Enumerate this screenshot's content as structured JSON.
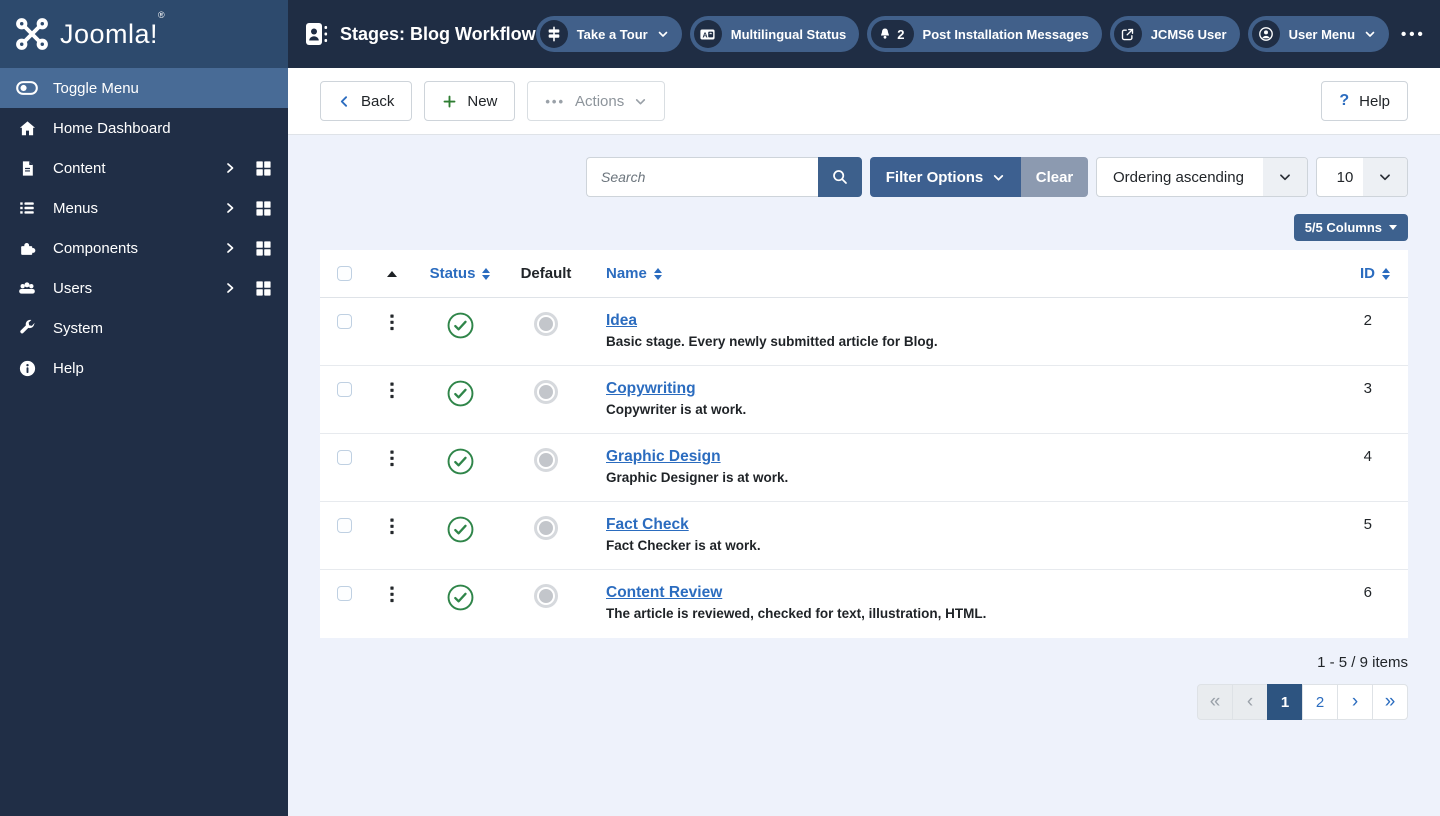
{
  "header": {
    "logo_text": "Joomla!",
    "logo_reg": "®",
    "title": "Stages: Blog Workflow",
    "pills": [
      {
        "label": "Take a Tour",
        "icon": "signpost-icon",
        "has_chevron": true
      },
      {
        "label": "Multilingual Status",
        "icon": "language-icon"
      },
      {
        "label": "Post Installation Messages",
        "icon": "bell-icon",
        "badge": "2"
      },
      {
        "label": "JCMS6 User",
        "icon": "external-link-icon"
      },
      {
        "label": "User Menu",
        "icon": "user-icon",
        "has_chevron": true
      }
    ],
    "overflow_icon": "•••"
  },
  "sidebar": {
    "toggle_label": "Toggle Menu",
    "items": [
      {
        "label": "Home Dashboard",
        "icon": "home-icon"
      },
      {
        "label": "Content",
        "icon": "document-icon",
        "has_submenu": true,
        "has_grid": true
      },
      {
        "label": "Menus",
        "icon": "list-icon",
        "has_submenu": true,
        "has_grid": true
      },
      {
        "label": "Components",
        "icon": "puzzle-icon",
        "has_submenu": true,
        "has_grid": true
      },
      {
        "label": "Users",
        "icon": "users-icon",
        "has_submenu": true,
        "has_grid": true
      },
      {
        "label": "System",
        "icon": "wrench-icon"
      },
      {
        "label": "Help",
        "icon": "info-icon"
      }
    ]
  },
  "toolbar": {
    "back_label": "Back",
    "new_label": "New",
    "actions_label": "Actions",
    "actions_dots": "•••",
    "help_label": "Help",
    "help_icon": "?"
  },
  "filters": {
    "search_placeholder": "Search",
    "filter_options_label": "Filter Options",
    "clear_label": "Clear",
    "ordering_value": "Ordering ascending",
    "per_page_value": "10",
    "columns_label": "5/5 Columns"
  },
  "table": {
    "headers": {
      "status": "Status",
      "default": "Default",
      "name": "Name",
      "id": "ID"
    },
    "rows": [
      {
        "name": "Idea",
        "desc": "Basic stage. Every newly submitted article for Blog.",
        "id": "2",
        "status": "published",
        "default": false
      },
      {
        "name": "Copywriting",
        "desc": "Copywriter is at work.",
        "id": "3",
        "status": "published",
        "default": false
      },
      {
        "name": "Graphic Design",
        "desc": "Graphic Designer is at work.",
        "id": "4",
        "status": "published",
        "default": false
      },
      {
        "name": "Fact Check",
        "desc": "Fact Checker is at work.",
        "id": "5",
        "status": "published",
        "default": false
      },
      {
        "name": "Content Review",
        "desc": "The article is reviewed, checked for text, illustration, HTML.",
        "id": "6",
        "status": "published",
        "default": false
      }
    ]
  },
  "pagination": {
    "summary": "1 - 5 / 9 items",
    "first_icon": "«",
    "prev_icon": "‹",
    "next_icon": "›",
    "last_icon": "»",
    "pages": [
      "1",
      "2"
    ],
    "active_page": "1"
  },
  "colors": {
    "header_bg": "#1f2d44",
    "logo_area_bg": "#2d4a6d",
    "sidebar_bg": "#202e46",
    "sidebar_active_bg": "#486b96",
    "pill_bg": "#41608a",
    "content_bg": "#eef2fb",
    "accent_steel_blue": "#3d6090",
    "clear_gray_blue": "#8c9ab0",
    "link_blue": "#2b6cbf",
    "status_green": "#2f8549",
    "active_page_bg": "#2d5480",
    "new_plus_green": "#2e7d32"
  }
}
